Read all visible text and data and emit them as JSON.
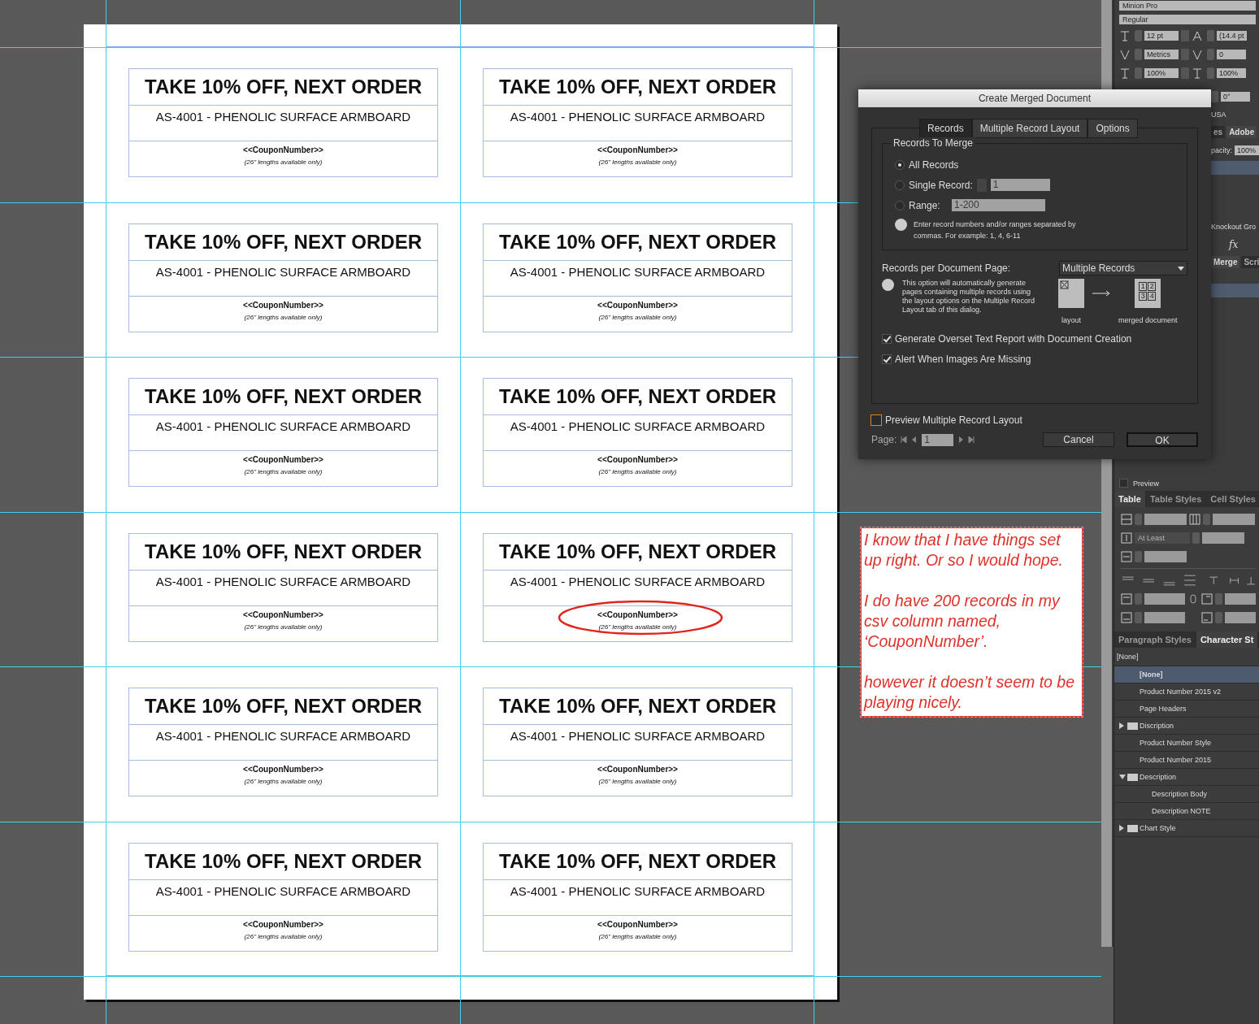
{
  "coupons": [
    {
      "title": "TAKE 10% OFF, NEXT ORDER",
      "product": "AS-4001 - PHENOLIC SURFACE ARMBOARD",
      "code": "<<CouponNumber>>",
      "note": "(26\" lengths available only)",
      "circled": false
    },
    {
      "title": "TAKE 10% OFF, NEXT ORDER",
      "product": "AS-4001 - PHENOLIC SURFACE ARMBOARD",
      "code": "<<CouponNumber>>",
      "note": "(26\" lengths available only)",
      "circled": false
    },
    {
      "title": "TAKE 10% OFF, NEXT ORDER",
      "product": "AS-4001 - PHENOLIC SURFACE ARMBOARD",
      "code": "<<CouponNumber>>",
      "note": "(26\" lengths available only)",
      "circled": false
    },
    {
      "title": "TAKE 10% OFF, NEXT ORDER",
      "product": "AS-4001 - PHENOLIC SURFACE ARMBOARD",
      "code": "<<CouponNumber>>",
      "note": "(26\" lengths available only)",
      "circled": false
    },
    {
      "title": "TAKE 10% OFF, NEXT ORDER",
      "product": "AS-4001 - PHENOLIC SURFACE ARMBOARD",
      "code": "<<CouponNumber>>",
      "note": "(26\" lengths available only)",
      "circled": false
    },
    {
      "title": "TAKE 10% OFF, NEXT ORDER",
      "product": "AS-4001 - PHENOLIC SURFACE ARMBOARD",
      "code": "<<CouponNumber>>",
      "note": "(26\" lengths available only)",
      "circled": false
    },
    {
      "title": "TAKE 10% OFF, NEXT ORDER",
      "product": "AS-4001 - PHENOLIC SURFACE ARMBOARD",
      "code": "<<CouponNumber>>",
      "note": "(26\" lengths available only)",
      "circled": false
    },
    {
      "title": "TAKE 10% OFF, NEXT ORDER",
      "product": "AS-4001 - PHENOLIC SURFACE ARMBOARD",
      "code": "<<CouponNumber>>",
      "note": "(26\" lengths available only)",
      "circled": true
    },
    {
      "title": "TAKE 10% OFF, NEXT ORDER",
      "product": "AS-4001 - PHENOLIC SURFACE ARMBOARD",
      "code": "<<CouponNumber>>",
      "note": "(26\" lengths available only)",
      "circled": false
    },
    {
      "title": "TAKE 10% OFF, NEXT ORDER",
      "product": "AS-4001 - PHENOLIC SURFACE ARMBOARD",
      "code": "<<CouponNumber>>",
      "note": "(26\" lengths available only)",
      "circled": false
    },
    {
      "title": "TAKE 10% OFF, NEXT ORDER",
      "product": "AS-4001 - PHENOLIC SURFACE ARMBOARD",
      "code": "<<CouponNumber>>",
      "note": "(26\" lengths available only)",
      "circled": false
    },
    {
      "title": "TAKE 10% OFF, NEXT ORDER",
      "product": "AS-4001 - PHENOLIC SURFACE ARMBOARD",
      "code": "<<CouponNumber>>",
      "note": "(26\" lengths available only)",
      "circled": false
    }
  ],
  "dialog": {
    "title": "Create Merged Document",
    "tabs": [
      {
        "label": "Records",
        "selected": true
      },
      {
        "label": "Multiple Record Layout",
        "selected": false
      },
      {
        "label": "Options",
        "selected": false
      }
    ],
    "merge_group": {
      "legend": "Records To Merge",
      "options": [
        {
          "label": "All Records",
          "selected": true
        },
        {
          "label": "Single Record:",
          "selected": false,
          "value": "1",
          "stepper": true
        },
        {
          "label": "Range:",
          "selected": false,
          "value": "1-200",
          "stepper": false
        }
      ],
      "info": "Enter record numbers and/or ranges separated by commas. For example: 1, 4, 6-11"
    },
    "per_page": {
      "label": "Records per Document Page:",
      "value": "Multiple Records",
      "info": "This option will automatically generate pages containing multiple records using the layout options on the Multiple Record Layout tab of this dialog.",
      "layout_caption": "layout",
      "merged_caption": "merged document",
      "cells": [
        "1",
        "2",
        "3",
        "4"
      ]
    },
    "checkboxes": [
      {
        "label": "Generate Overset Text Report with Document Creation",
        "checked": true
      },
      {
        "label": "Alert When Images Are Missing",
        "checked": true
      }
    ],
    "preview": {
      "label": "Preview Multiple Record Layout",
      "checked": false
    },
    "page": {
      "label": "Page:",
      "value": "1"
    },
    "buttons": [
      {
        "label": "Cancel",
        "default": false
      },
      {
        "label": "OK",
        "default": true
      }
    ]
  },
  "annotation": [
    "I know that I have things set up right. Or so I would hope.",
    "I do have 200 records in my csv column named, ‘CouponNumber’.",
    "however it doesn’t seem to be playing nicely."
  ],
  "panel": {
    "font": "Minion Pro",
    "style": "Regular",
    "size": "12 pt",
    "leading": "(14.4 pt",
    "kerning": "Metrics",
    "tracking": "0",
    "vscale": "100%",
    "hscale": "100%",
    "skew": "0°",
    "language": "USA",
    "effects_tabs": [
      {
        "label": "es",
        "selected": false
      },
      {
        "label": "Adobe",
        "selected": true
      }
    ],
    "opacity_label": "pacity:",
    "opacity": "100%",
    "knockout": "Knockout Gro",
    "effects_label": "fx",
    "script_tabs": [
      {
        "label": "Merge",
        "selected": true
      },
      {
        "label": "Scri",
        "selected": false
      }
    ],
    "preview": {
      "label": "Preview",
      "checked": false
    },
    "table_tabs": [
      {
        "label": "Table",
        "selected": true
      },
      {
        "label": "Table Styles",
        "selected": false
      },
      {
        "label": "Cell Styles",
        "selected": false
      }
    ],
    "row_height_mode": "At Least",
    "style_tabs": [
      {
        "label": "Paragraph Styles",
        "selected": false
      },
      {
        "label": "Character St",
        "selected": true
      }
    ],
    "current_style": "[None]",
    "styles": [
      {
        "label": "[None]",
        "kind": "style",
        "selected": true
      },
      {
        "label": "Product Number 2015 v2",
        "kind": "style",
        "selected": false
      },
      {
        "label": "Page Headers",
        "kind": "style",
        "selected": false
      },
      {
        "label": "Discription",
        "kind": "group",
        "expanded": false,
        "selected": false
      },
      {
        "label": "Product Number Style",
        "kind": "style",
        "selected": false
      },
      {
        "label": "Product Number 2015",
        "kind": "style",
        "selected": false
      },
      {
        "label": "Description",
        "kind": "group",
        "expanded": true,
        "selected": false,
        "children": [
          {
            "label": "Description Body",
            "kind": "style",
            "selected": false
          },
          {
            "label": "Description NOTE",
            "kind": "style",
            "selected": false
          }
        ]
      },
      {
        "label": "Chart Style",
        "kind": "group",
        "expanded": false,
        "selected": false
      }
    ]
  }
}
